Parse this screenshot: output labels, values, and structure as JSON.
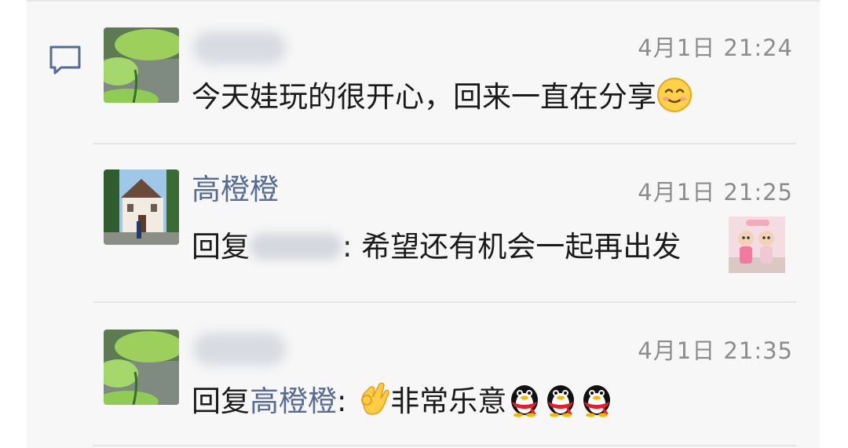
{
  "colors": {
    "link": "#576b95",
    "time": "#8c8c8c",
    "text": "#1b1b1b",
    "panel": "#f7f7f7"
  },
  "comments": [
    {
      "author": "",
      "author_blurred": true,
      "time": "4月1日 21:24",
      "text": "今天娃玩的很开心，回来一直在分享",
      "emoji": "smile-emoji"
    },
    {
      "author": "高橙橙",
      "author_blurred": false,
      "time": "4月1日 21:25",
      "reply_prefix": "回复",
      "reply_target": "",
      "separator": ":",
      "text": " 希望还有机会一起再出发",
      "attachment": "photo-thumbnail"
    },
    {
      "author": "",
      "author_blurred": true,
      "time": "4月1日 21:35",
      "reply_prefix": "回复",
      "reply_target": "高橙橙",
      "separator": ":",
      "text": "非常乐意",
      "emojis": [
        "ok-hand-emoji",
        "qq-penguin-emoji",
        "qq-penguin-emoji",
        "qq-penguin-emoji"
      ]
    }
  ]
}
